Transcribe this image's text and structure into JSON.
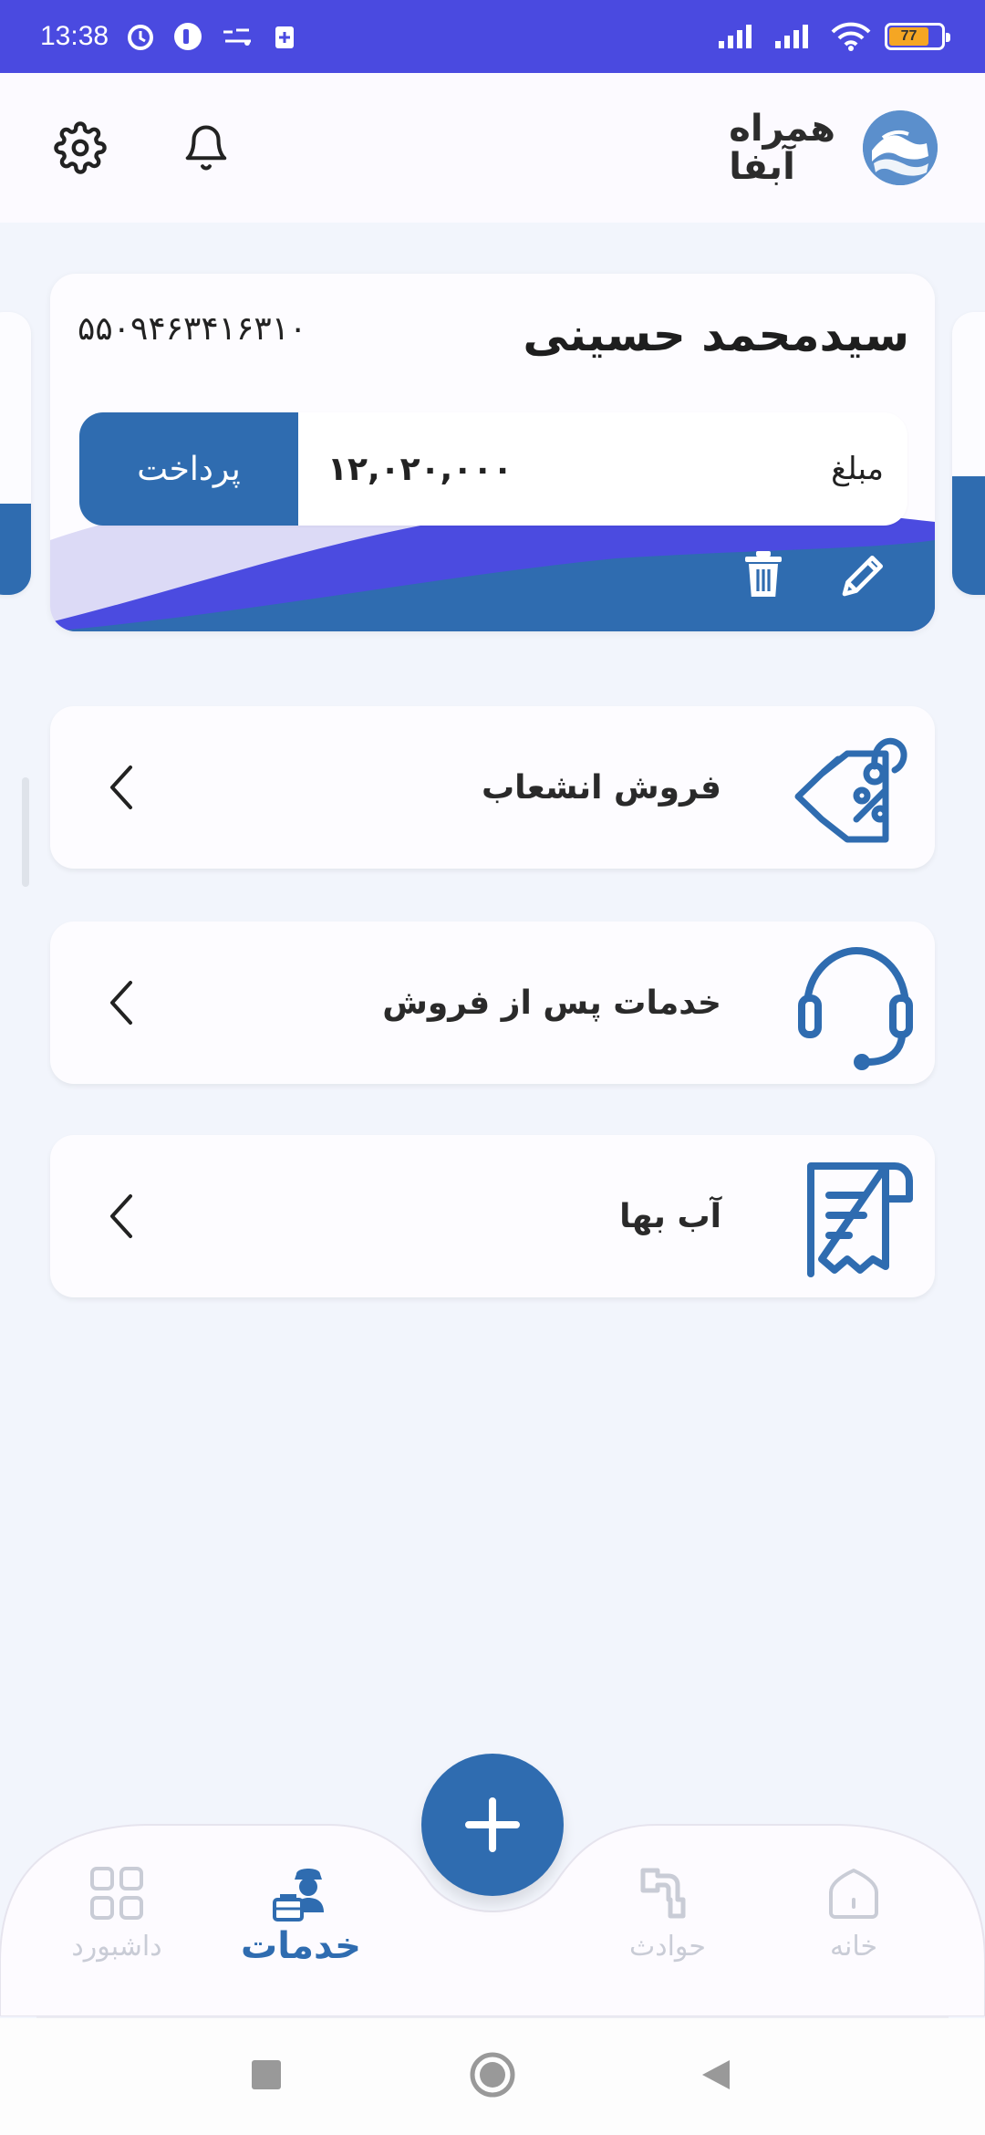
{
  "status_bar": {
    "time": "13:38",
    "battery_level": "77",
    "battery_fill_fraction": 0.77,
    "icons": [
      "alarm-icon",
      "app-notification-icon",
      "hamrah-abfa-icon",
      "battery-saver-icon",
      "signal-icon",
      "signal-icon",
      "wifi-icon",
      "battery-icon"
    ]
  },
  "header": {
    "brand_line1": "همراه",
    "brand_line2": "آبفا",
    "icons": [
      "settings-icon",
      "bell-icon",
      "logo-icon"
    ]
  },
  "bill_card": {
    "customer_name": "سیدمحمد حسینی",
    "bill_id": "۵۵۰۹۴۶۳۴۱۶۳۱۰",
    "amount_label": "مبلغ",
    "amount_value": "۱۲,۰۲۰,۰۰۰",
    "pay_button": "پرداخت",
    "icons": [
      "edit-icon",
      "trash-icon"
    ]
  },
  "services": [
    {
      "label": "فروش انشعاب",
      "icon": "discount-tag-icon"
    },
    {
      "label": "خدمات پس از فروش",
      "icon": "headset-icon"
    },
    {
      "label": "آب بها",
      "icon": "receipt-icon"
    }
  ],
  "bottom_nav": {
    "items": [
      {
        "label": "خانه",
        "icon": "home-icon",
        "active": false
      },
      {
        "label": "حوادث",
        "icon": "pipe-icon",
        "active": false
      },
      {
        "label": "خدمات",
        "icon": "worker-icon",
        "active": true
      },
      {
        "label": "داشبورد",
        "icon": "dashboard-icon",
        "active": false
      }
    ],
    "fab_icon": "plus-icon"
  },
  "colors": {
    "status_bar": "#4a4ae0",
    "primary": "#2f6cb0",
    "wave_purple": "#4b4be0",
    "wave_lavender": "#dcdaf6",
    "background": "#f2f5fc",
    "card": "#fdfcff",
    "inactive": "#c9ccd6"
  }
}
